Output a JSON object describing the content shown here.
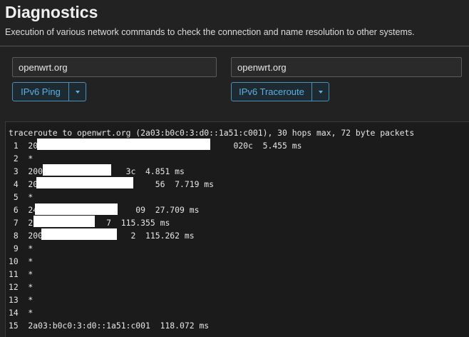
{
  "page": {
    "title": "Diagnostics",
    "description": "Execution of various network commands to check the connection and name resolution to other systems."
  },
  "ping_panel": {
    "host_value": "openwrt.org",
    "button_label": "IPv6 Ping"
  },
  "traceroute_panel": {
    "host_value": "openwrt.org",
    "button_label": "IPv6 Traceroute"
  },
  "output": {
    "lines": [
      "traceroute to openwrt.org (2a03:b0c0:3:d0::1a51:c001), 30 hops max, 72 byte packets",
      " 1  20                                        020c  5.455 ms",
      " 2  *",
      " 3  200                 3c  4.851 ms",
      " 4  20                        56  7.719 ms",
      " 5  *",
      " 6  24                    09  27.709 ms",
      " 7  2               7  115.355 ms",
      " 8  200                  2  115.262 ms",
      " 9  *",
      "10  *",
      "11  *",
      "12  *",
      "13  *",
      "14  *",
      "15  2a03:b0c0:3:d0::1a51:c001  118.072 ms"
    ]
  },
  "colors": {
    "background": "#222222",
    "button_accent": "#5ab0e0",
    "redaction": "#ffffff"
  },
  "icons": [
    "caret-down-icon"
  ]
}
